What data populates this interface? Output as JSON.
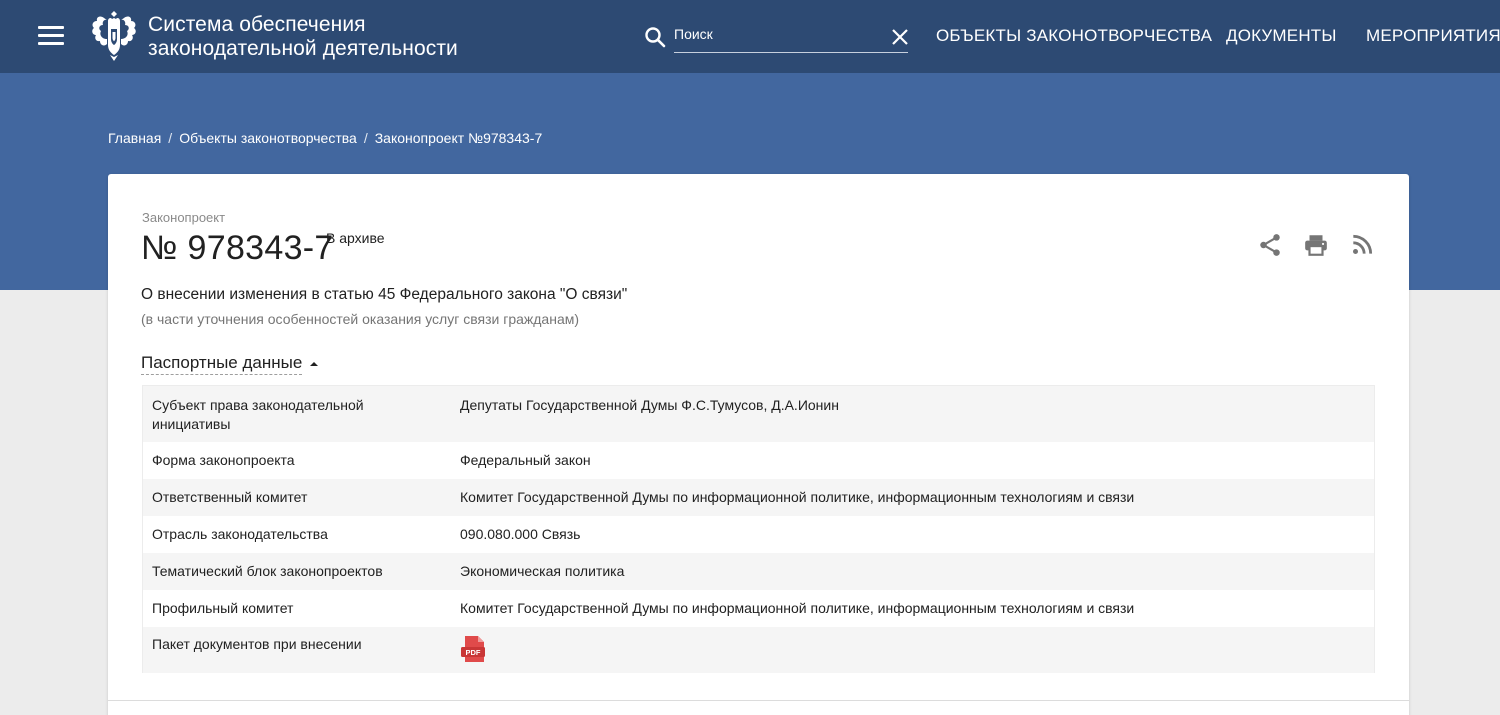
{
  "header": {
    "site_title_line1": "Система обеспечения",
    "site_title_line2": "законодательной деятельности",
    "search_placeholder": "Поиск",
    "search_value": "",
    "nav": [
      "ОБЪЕКТЫ ЗАКОНОТВОРЧЕСТВА",
      "ДОКУМЕНТЫ",
      "МЕРОПРИЯТИЯ"
    ]
  },
  "breadcrumb": [
    "Главная",
    "Объекты законотворчества",
    "Законопроект №978343-7"
  ],
  "bill": {
    "type_label": "Законопроект",
    "number": "№ 978343-7",
    "status": "В архиве",
    "title": "О внесении изменения в статью 45 Федерального закона \"О связи\"",
    "note": "(в части уточнения особенностей оказания услуг связи гражданам)"
  },
  "passport": {
    "toggle_label": "Паспортные данные",
    "rows": [
      {
        "key_line1": "Субъект права законодательной",
        "key_line2": "инициативы",
        "value": "Депутаты Государственной Думы Ф.С.Тумусов, Д.А.Ионин"
      },
      {
        "key": "Форма законопроекта",
        "value": "Федеральный закон"
      },
      {
        "key": "Ответственный комитет",
        "value": "Комитет Государственной Думы по информационной политике, информационным технологиям и связи"
      },
      {
        "key": "Отрасль законодательства",
        "value": "090.080.000 Связь"
      },
      {
        "key": "Тематический блок законопроектов",
        "value": "Экономическая политика"
      },
      {
        "key": "Профильный комитет",
        "value": "Комитет Государственной Думы по информационной политике, информационным технологиям и связи"
      },
      {
        "key": "Пакет документов при внесении",
        "file_label": "PDF"
      }
    ]
  },
  "icons": {
    "menu": "menu-icon",
    "emblem": "coat-of-arms-emblem",
    "search": "search-icon",
    "clear": "close-icon",
    "share": "share-icon",
    "print": "print-icon",
    "rss": "rss-icon",
    "pdf": "pdf-file-icon",
    "caret": "caret-up-icon"
  },
  "colors": {
    "topbar": "#2d4a73",
    "band": "#42679f",
    "pdf": "#e04a4a",
    "icon_gray": "#757575"
  }
}
